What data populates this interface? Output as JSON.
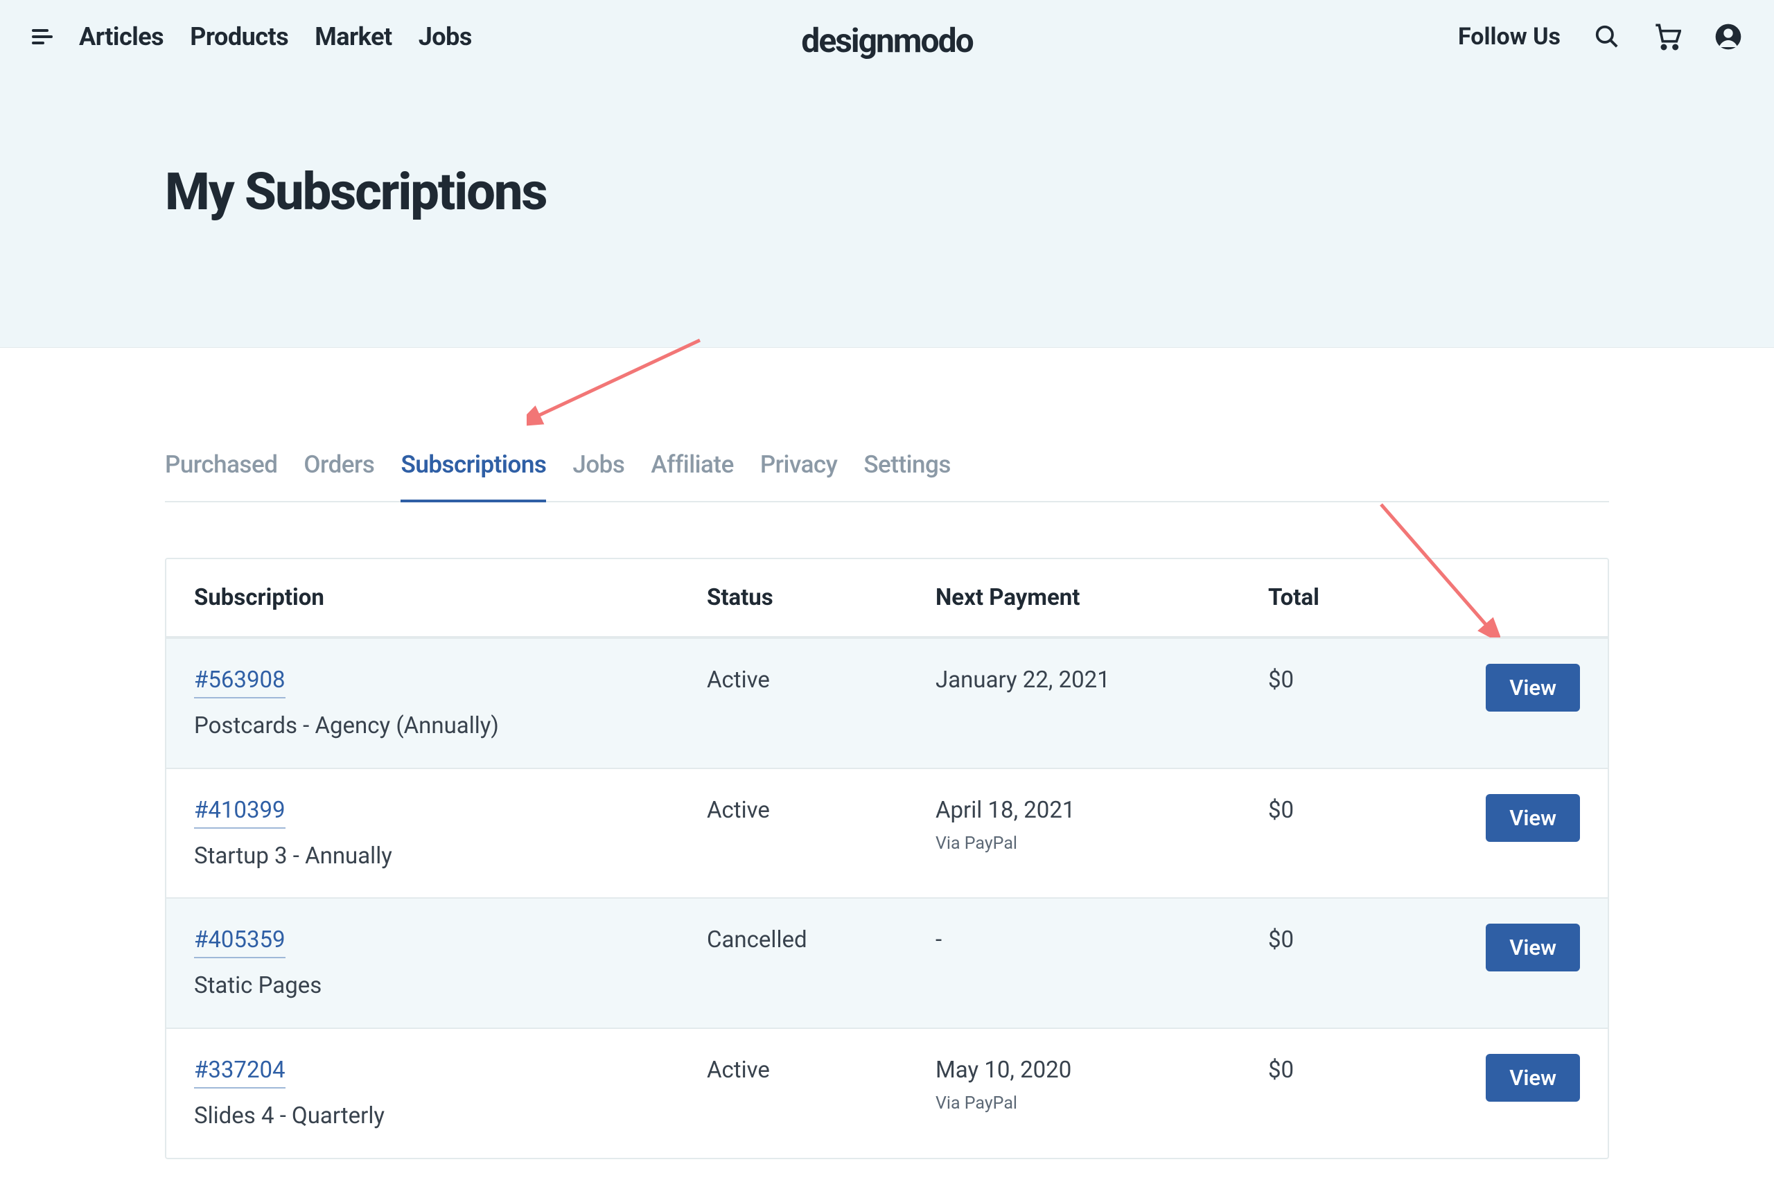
{
  "header": {
    "nav": [
      "Articles",
      "Products",
      "Market",
      "Jobs"
    ],
    "logo": "designmodo",
    "follow": "Follow Us"
  },
  "page_title": "My Subscriptions",
  "tabs": [
    {
      "label": "Purchased",
      "active": false
    },
    {
      "label": "Orders",
      "active": false
    },
    {
      "label": "Subscriptions",
      "active": true
    },
    {
      "label": "Jobs",
      "active": false
    },
    {
      "label": "Affiliate",
      "active": false
    },
    {
      "label": "Privacy",
      "active": false
    },
    {
      "label": "Settings",
      "active": false
    }
  ],
  "table": {
    "columns": [
      "Subscription",
      "Status",
      "Next Payment",
      "Total"
    ],
    "rows": [
      {
        "id": "#563908",
        "name": "Postcards - Agency (Annually)",
        "status": "Active",
        "next_payment": "January 22, 2021",
        "via": "",
        "total": "$0",
        "action": "View"
      },
      {
        "id": "#410399",
        "name": "Startup 3 - Annually",
        "status": "Active",
        "next_payment": "April 18, 2021",
        "via": "Via PayPal",
        "total": "$0",
        "action": "View"
      },
      {
        "id": "#405359",
        "name": "Static Pages",
        "status": "Cancelled",
        "next_payment": "-",
        "via": "",
        "total": "$0",
        "action": "View"
      },
      {
        "id": "#337204",
        "name": "Slides 4 - Quarterly",
        "status": "Active",
        "next_payment": "May 10, 2020",
        "via": "Via PayPal",
        "total": "$0",
        "action": "View"
      }
    ]
  }
}
